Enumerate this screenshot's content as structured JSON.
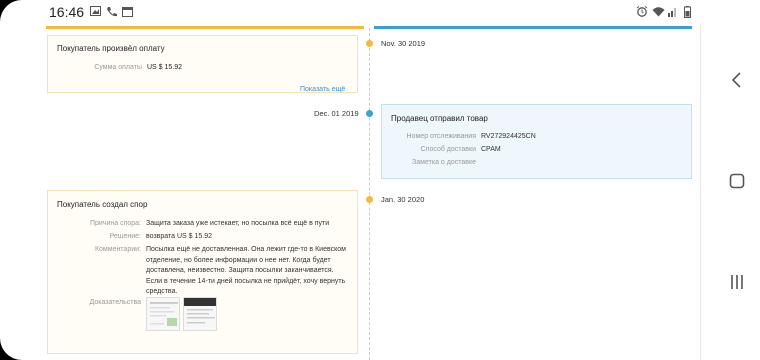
{
  "status": {
    "time": "16:46"
  },
  "events": [
    {
      "date": "Nov. 30 2019",
      "title": "Покупатель произвёл оплату",
      "rows": [
        {
          "label": "Сумма оплаты",
          "value": "US $ 15.92"
        }
      ],
      "link": "Показать ещё"
    },
    {
      "date": "Dec. 01 2019",
      "title": "Продавец отправил товар",
      "rows": [
        {
          "label": "Номер отслеживания",
          "value": "RV272924425CN"
        },
        {
          "label": "Способ доставки",
          "value": "CPAM"
        },
        {
          "label": "Заметка о доставке",
          "value": ""
        }
      ]
    },
    {
      "date": "Jan. 30 2020",
      "title": "Покупатель создал спор",
      "rows": [
        {
          "label": "Причина спора:",
          "value": "Защита заказа уже истекает, но посылка всё ещё в пути"
        },
        {
          "label": "Решение:",
          "value": "возврата US $ 15.92"
        },
        {
          "label": "Комментарии:",
          "value": "Посылка ещё не доставленная. Она лежит где-то в Киевском отделение, но более информации о нее нет. Когда будет доставлена, неизвестно. Защита посылки заканчивается. Если в течение 14-ти дней посылка не прийдёт, хочу вернуть средства."
        },
        {
          "label": "Доказательства",
          "value": ""
        }
      ]
    }
  ]
}
